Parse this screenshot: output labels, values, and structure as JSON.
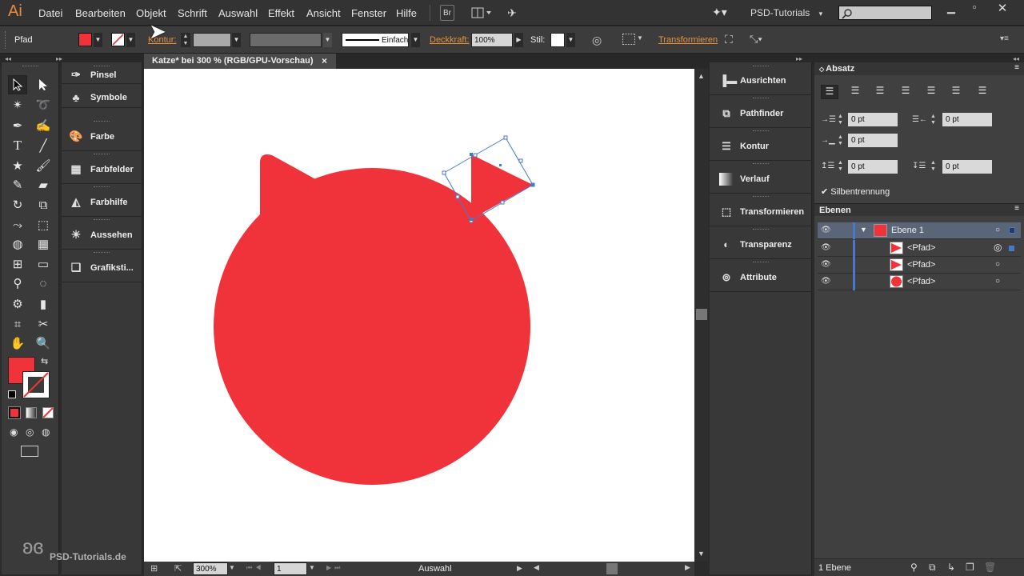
{
  "app": {
    "logo": "Ai",
    "workspace": "PSD-Tutorials",
    "workspace_arrow": "▾"
  },
  "menu": [
    "Datei",
    "Bearbeiten",
    "Objekt",
    "Schrift",
    "Auswahl",
    "Effekt",
    "Ansicht",
    "Fenster",
    "Hilfe"
  ],
  "menubar_buttons": {
    "bridge": "Br"
  },
  "control": {
    "selection_type": "Pfad",
    "stroke_label": "Kontur:",
    "stroke_profile": "Einfach",
    "opacity_label": "Deckkraft:",
    "opacity_value": "100%",
    "style_label": "Stil:",
    "transform_link": "Transformieren",
    "fill_color": "#f0323a"
  },
  "document": {
    "tab_title": "Katze* bei 300 % (RGB/GPU-Vorschau)",
    "close": "×"
  },
  "status": {
    "zoom": "300%",
    "artboard": "1",
    "tool": "Auswahl"
  },
  "left_panels": [
    "Pinsel",
    "Symbole",
    "Farbe",
    "Farbfelder",
    "Farbhilfe",
    "Aussehen",
    "Grafiksti..."
  ],
  "right_panels": [
    "Ausrichten",
    "Pathfinder",
    "Kontur",
    "Verlauf",
    "Transformieren",
    "Transparenz",
    "Attribute"
  ],
  "absatz": {
    "title": "Absatz",
    "indent_left": "0 pt",
    "indent_right": "0 pt",
    "first_line": "0 pt",
    "space_before": "0 pt",
    "space_after": "0 pt",
    "hyphenation": "Silbentrennung"
  },
  "layers": {
    "title": "Ebenen",
    "layer": "Ebene 1",
    "items": [
      "<Pfad>",
      "<Pfad>",
      "<Pfad>"
    ],
    "footer": "1 Ebene"
  },
  "watermark": "PSD-Tutorials.de",
  "colors": {
    "accent_red": "#f0323a",
    "layer_blue": "#4a78c8",
    "link_orange": "#e8923a"
  }
}
